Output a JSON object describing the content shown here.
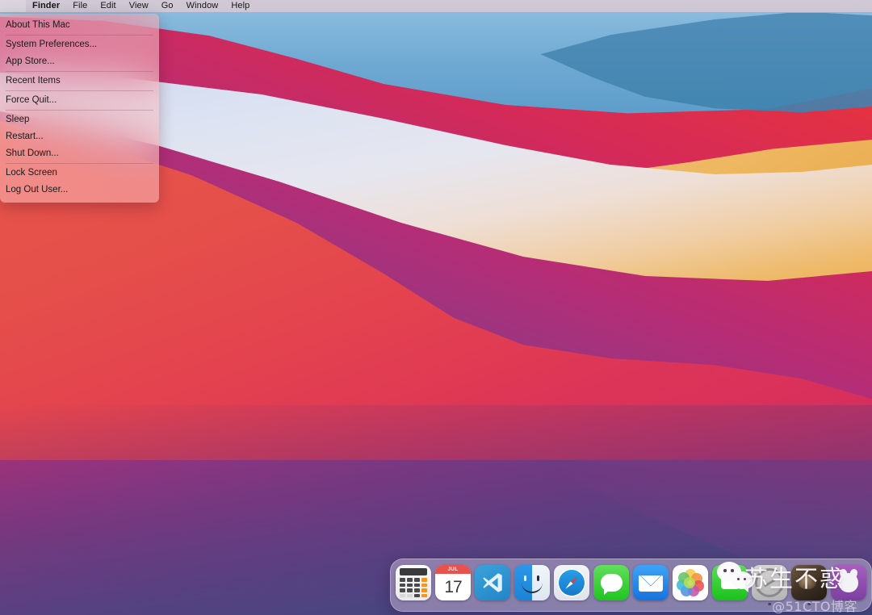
{
  "desktop": {
    "os": "macOS Big Sur",
    "wallpaper_name": "big-sur-gradient-wallpaper"
  },
  "menubar": {
    "apple_glyph": "",
    "items": [
      {
        "label": "Finder",
        "bold": true
      },
      {
        "label": "File",
        "bold": false
      },
      {
        "label": "Edit",
        "bold": false
      },
      {
        "label": "View",
        "bold": false
      },
      {
        "label": "Go",
        "bold": false
      },
      {
        "label": "Window",
        "bold": false
      },
      {
        "label": "Help",
        "bold": false
      }
    ]
  },
  "apple_menu": {
    "groups": [
      {
        "items": [
          {
            "label": "About This Mac"
          }
        ]
      },
      {
        "items": [
          {
            "label": "System Preferences..."
          },
          {
            "label": "App Store..."
          }
        ]
      },
      {
        "items": [
          {
            "label": "Recent Items"
          }
        ]
      },
      {
        "items": [
          {
            "label": "Force Quit..."
          }
        ]
      },
      {
        "items": [
          {
            "label": "Sleep"
          },
          {
            "label": "Restart..."
          },
          {
            "label": "Shut Down..."
          }
        ]
      },
      {
        "items": [
          {
            "label": "Lock Screen"
          },
          {
            "label": "Log Out User..."
          }
        ]
      }
    ]
  },
  "dock": {
    "apps": [
      {
        "name": "Calculator",
        "icon": "calculator-icon",
        "running": false
      },
      {
        "name": "Calendar",
        "icon": "calendar-icon",
        "running": false,
        "month": "JUL",
        "day": "17"
      },
      {
        "name": "Visual Studio Code",
        "icon": "vscode-icon",
        "running": false
      },
      {
        "name": "Finder",
        "icon": "finder-icon",
        "running": false
      },
      {
        "name": "Safari",
        "icon": "safari-icon",
        "running": false
      },
      {
        "name": "Messages",
        "icon": "messages-icon",
        "running": false
      },
      {
        "name": "Mail",
        "icon": "mail-icon",
        "running": false
      },
      {
        "name": "Photos",
        "icon": "photos-icon",
        "running": false
      },
      {
        "name": "FaceTime",
        "icon": "facetime-icon",
        "running": false
      },
      {
        "name": "System App",
        "icon": "gray-app-icon",
        "running": true
      },
      {
        "name": "Photo Thumbnail",
        "icon": "photo-thumbnail-icon",
        "running": true
      },
      {
        "name": "Purple App",
        "icon": "purple-app-icon",
        "running": true
      }
    ],
    "floating_icon": "wechat-icon"
  },
  "watermark": {
    "main": "苏生不惑",
    "sub": "@51CTO博客"
  }
}
